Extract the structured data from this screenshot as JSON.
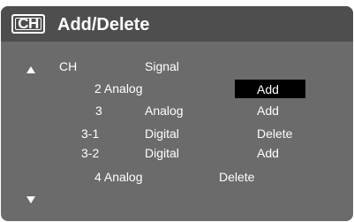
{
  "header": {
    "badge": "CH",
    "title": "Add/Delete"
  },
  "columns": {
    "ch": "CH",
    "signal": "Signal"
  },
  "rows": [
    {
      "channel_signal": "2 Analog",
      "action": "Add"
    },
    {
      "channel": "3",
      "signal": "Analog",
      "action": "Add"
    },
    {
      "channel": "3-1",
      "signal": "Digital",
      "action": "Delete"
    },
    {
      "channel": "3-2",
      "signal": "Digital",
      "action": "Add"
    },
    {
      "channel_signal": "4 Analog",
      "action": "Delete"
    }
  ],
  "icons": {
    "scroll_up": "up-arrow-icon",
    "scroll_down": "down-arrow-icon"
  },
  "colors": {
    "panel": "#6b6b6b",
    "header": "#4e4e4e",
    "text": "#ffffff",
    "selection": "#000000"
  }
}
